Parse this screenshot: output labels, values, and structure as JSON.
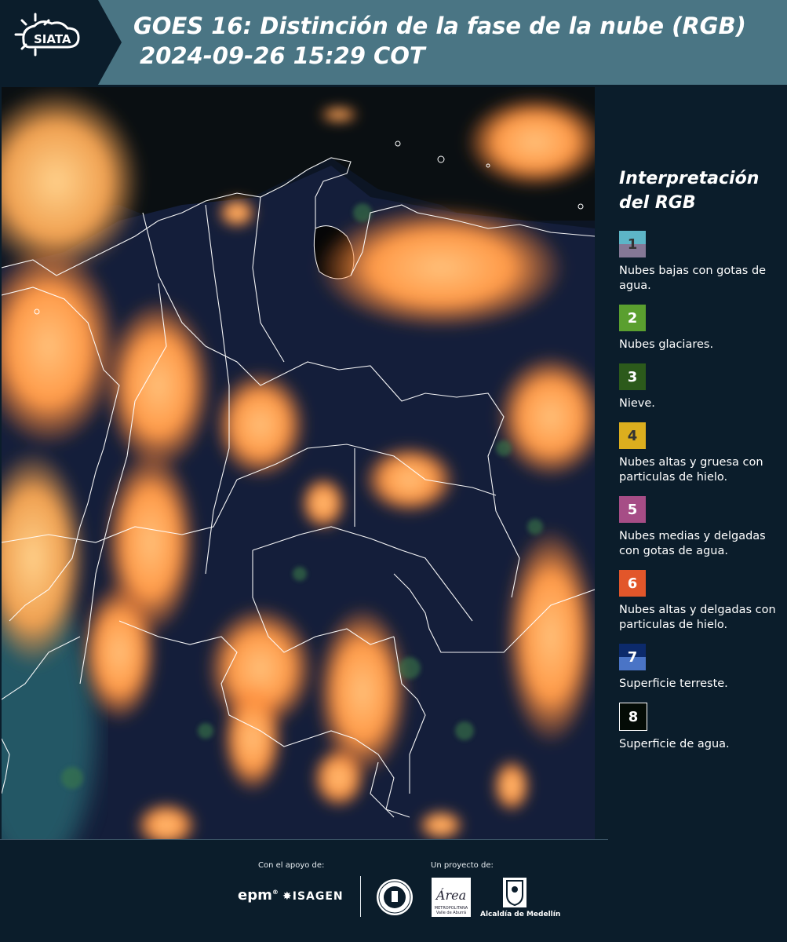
{
  "header": {
    "logo_text": "SIATA",
    "title_line1": "GOES 16: Distinción de la fase de la nube (RGB)",
    "title_line2": "2024-09-26 15:29 COT"
  },
  "legend": {
    "title_line1": "Interpretación",
    "title_line2": "del RGB",
    "items": [
      {
        "num": "1",
        "label": "Nubes bajas con gotas de agua.",
        "color_top": "#5db5c7",
        "color_bottom": "#857896"
      },
      {
        "num": "2",
        "label": "Nubes glaciares.",
        "color_top": "#5a9f2f",
        "color_bottom": "#5a9f2f"
      },
      {
        "num": "3",
        "label": "Nieve.",
        "color_top": "#2c5a1b",
        "color_bottom": "#2c5a1b"
      },
      {
        "num": "4",
        "label": "Nubes altas y gruesa con particulas de hielo.",
        "color_top": "#dcae1e",
        "color_bottom": "#dcae1e"
      },
      {
        "num": "5",
        "label": "Nubes medias y delgadas con gotas de agua.",
        "color_top": "#a64d86",
        "color_bottom": "#a64d86"
      },
      {
        "num": "6",
        "label": "Nubes altas y delgadas con particulas de hielo.",
        "color_top": "#e2562a",
        "color_bottom": "#e2562a"
      },
      {
        "num": "7",
        "label": "Superficie terreste.",
        "color_top": "#0c2a6b",
        "color_bottom": "#4a74c6"
      },
      {
        "num": "8",
        "label": "Superficie de agua.",
        "color_top": "#040b06",
        "color_bottom": "#040b06"
      }
    ]
  },
  "footer": {
    "support_label": "Con el apoyo de:",
    "project_label": "Un proyecto de:",
    "sponsor1": "epm",
    "sponsor2": "ISAGEN",
    "area_logo_text": "Área",
    "area_subtext": "METROPOLITANA Valle de Aburrá",
    "alcaldia": "Alcaldía de Medellín"
  }
}
